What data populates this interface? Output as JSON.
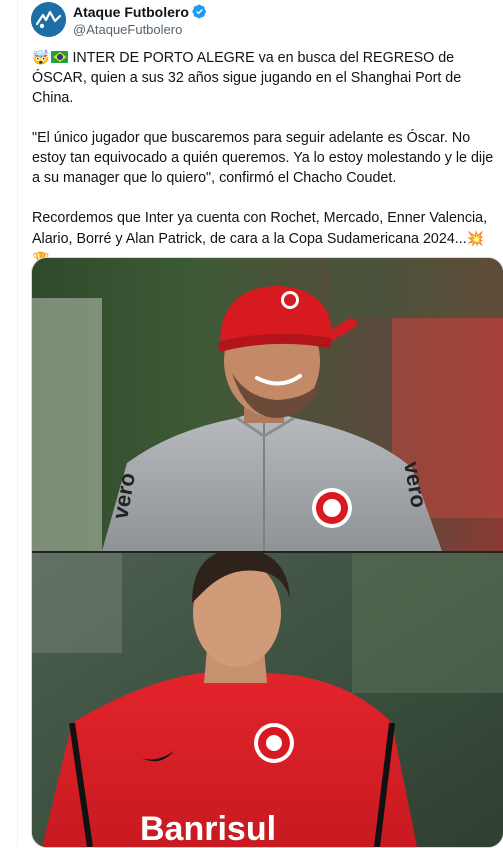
{
  "author": {
    "display_name": "Ataque Futbolero",
    "handle": "@AtaqueFutbolero",
    "verified": true,
    "avatar_icon": "ataque-futbolero-logo-icon"
  },
  "tweet": {
    "paragraphs": [
      {
        "lead_emoji": "🤯",
        "has_flag_br": true,
        "text": "INTER DE PORTO ALEGRE va en busca del REGRESO de ÓSCAR, quien a sus 32 años sigue jugando en el Shanghai Port de China.",
        "tail_emoji": ""
      },
      {
        "lead_emoji": "",
        "has_flag_br": false,
        "text": "\"El único jugador que buscaremos para seguir adelante es Óscar. No estoy tan equivocado a quién queremos. Ya lo estoy molestando y le dije a su manager que lo quiero\", confirmó el Chacho Coudet.",
        "tail_emoji": ""
      },
      {
        "lead_emoji": "",
        "has_flag_br": false,
        "text": "Recordemos que Inter ya cuenta con Rochet, Mercado, Enner Valencia, Alario, Borré y Alan Patrick, de cara a la Copa Sudamericana 2024...",
        "tail_emoji": "💥🏆"
      }
    ]
  },
  "media": {
    "top_photo_text": "vero",
    "bottom_photo_text": "Banrisul",
    "colors": {
      "inter_red": "#d71920",
      "jacket_grey": "#a9adb0",
      "border": "#cfd9de"
    }
  },
  "colors": {
    "verified": "#1d9bf0",
    "handle": "#536471",
    "text": "#0f1419"
  }
}
